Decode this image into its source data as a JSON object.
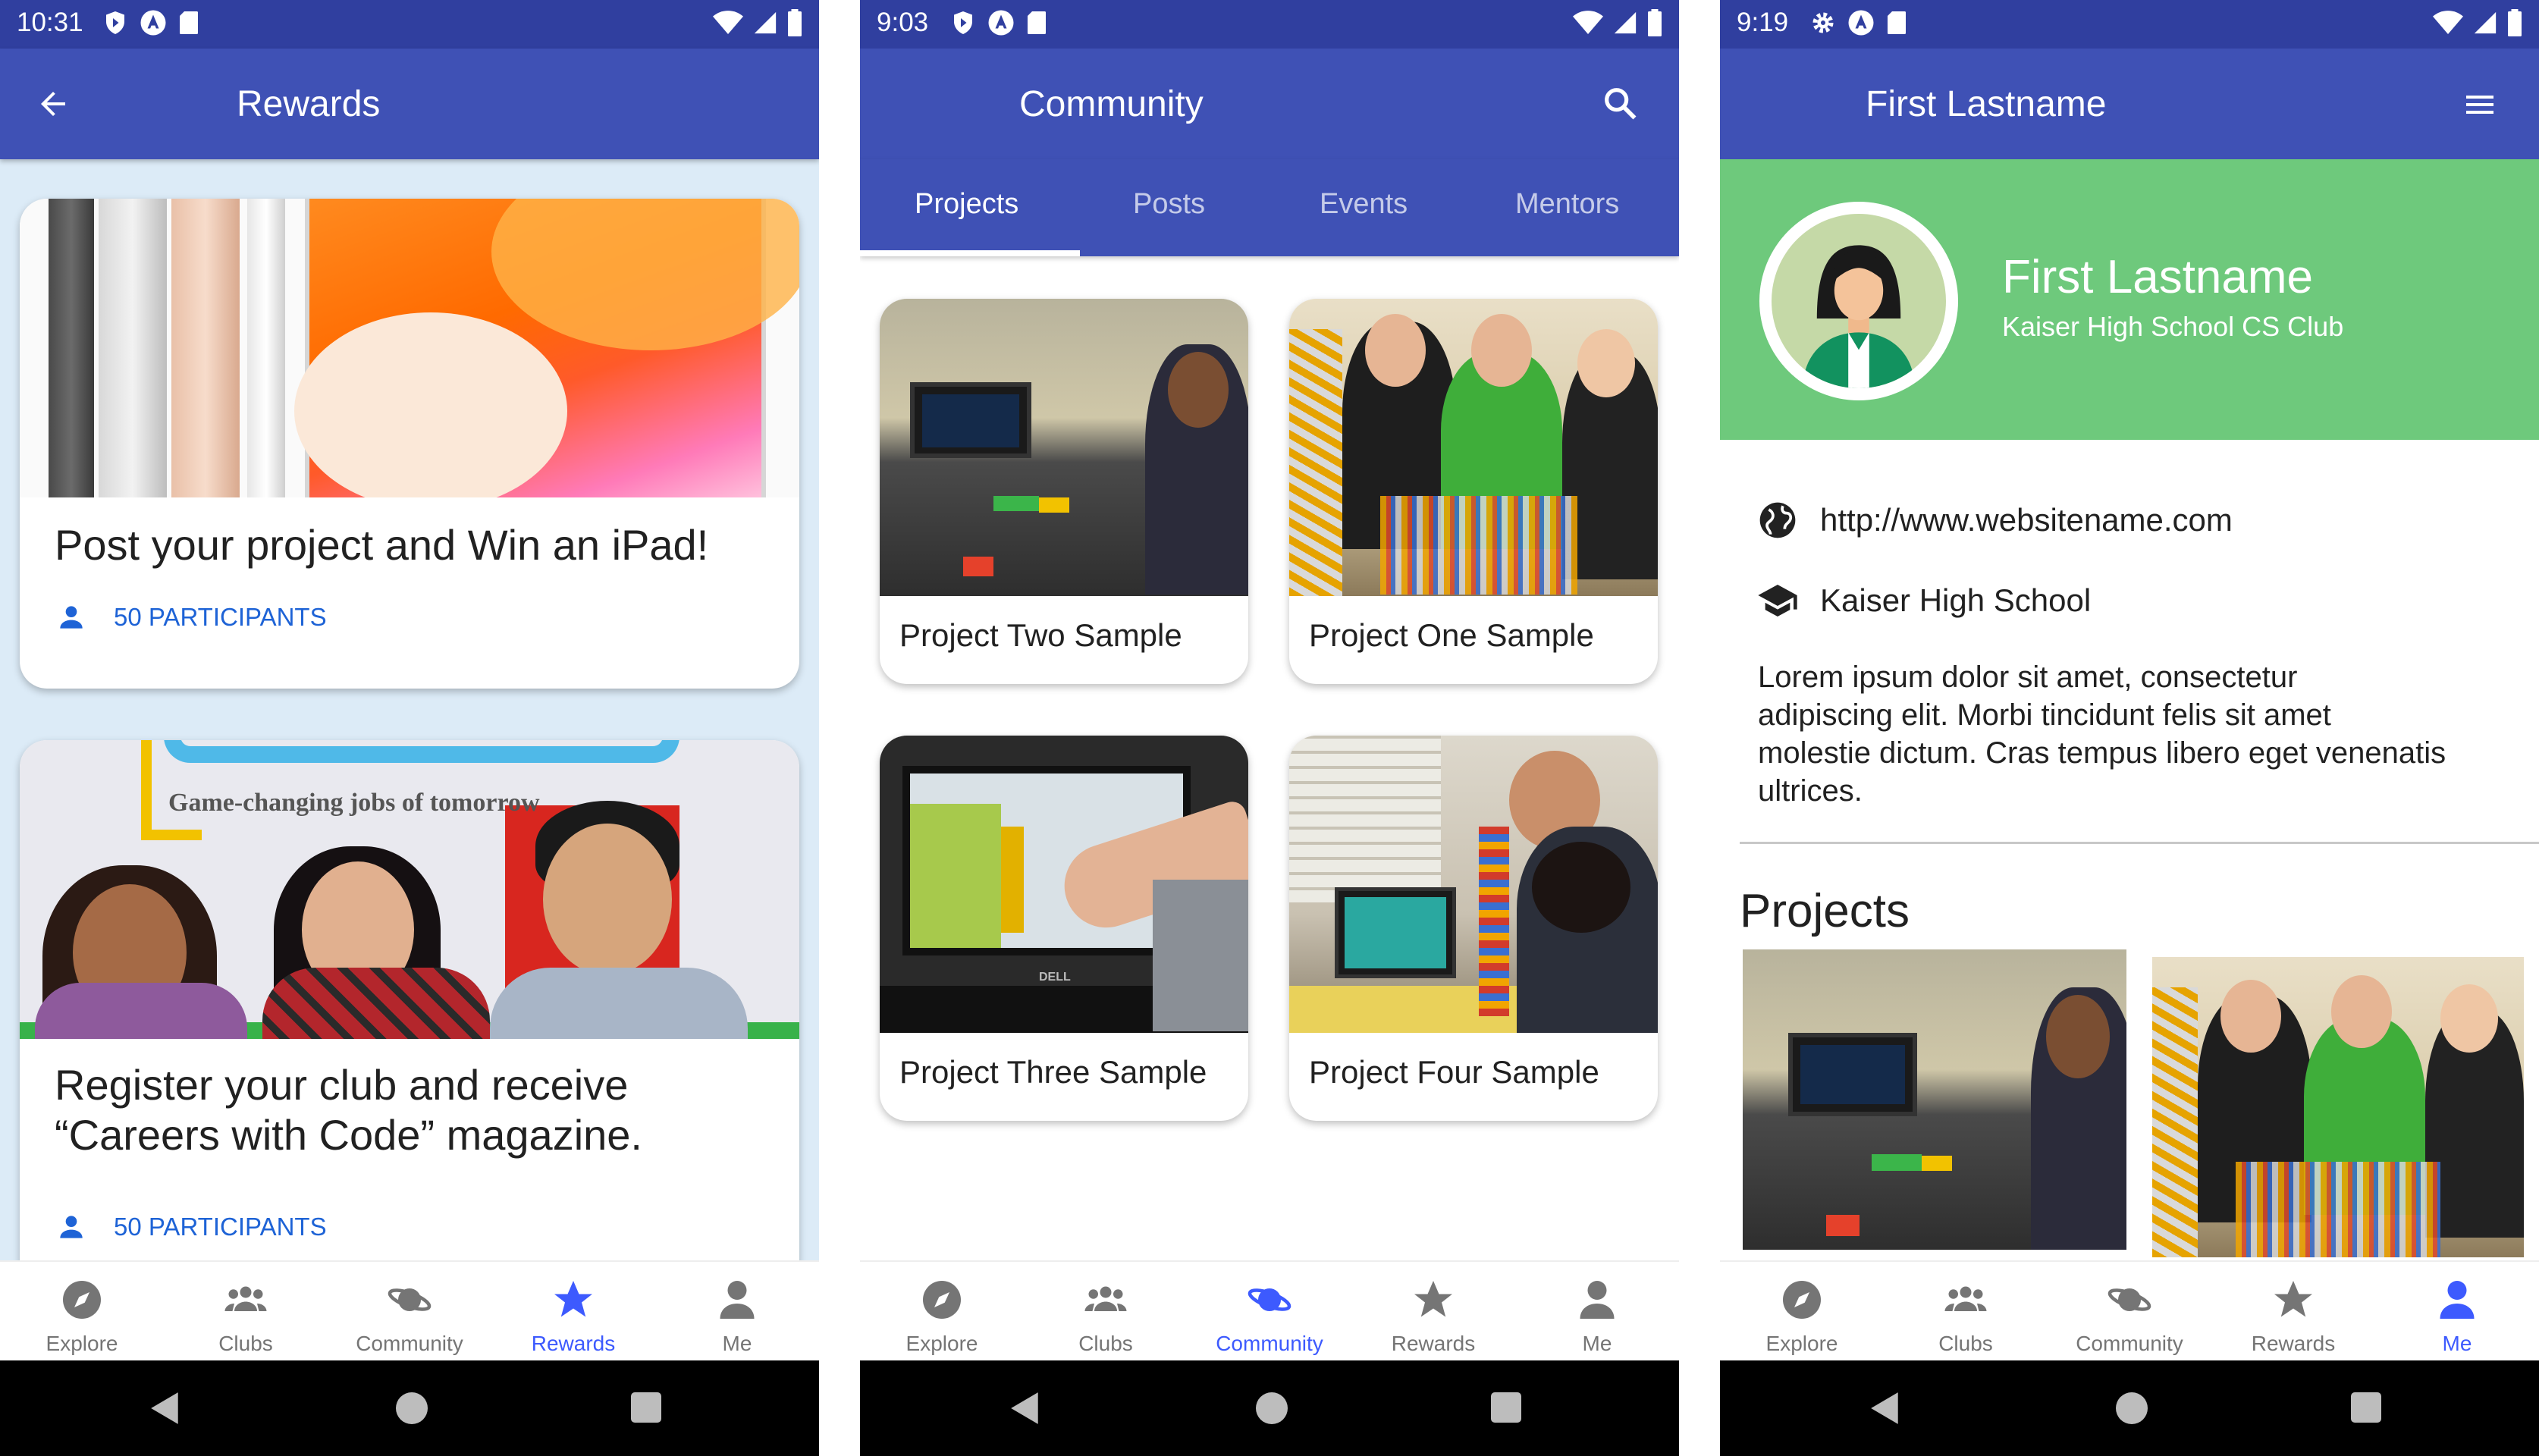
{
  "screens": [
    {
      "status_time": "10:31",
      "title": "Rewards",
      "rewards": [
        {
          "title_line1": "Post your project and Win an iPad!",
          "title_line2": "",
          "participants": "50 PARTICIPANTS"
        },
        {
          "title_line1": "Register your club and receive",
          "title_line2": "“Careers with Code” magazine.",
          "participants": "50 PARTICIPANTS"
        }
      ],
      "banner_text": "Game-changing jobs of tomorrow"
    },
    {
      "status_time": "9:03",
      "title": "Community",
      "tabs": [
        "Projects",
        "Posts",
        "Events",
        "Mentors"
      ],
      "projects": [
        "Project Two Sample",
        "Project One Sample",
        "Project Three Sample",
        "Project Four Sample"
      ]
    },
    {
      "status_time": "9:19",
      "title": "First Lastname",
      "profile": {
        "name": "First Lastname",
        "club": "Kaiser High School CS Club",
        "website": "http://www.websitename.com",
        "school": "Kaiser High School",
        "bio_lines": [
          "Lorem ipsum dolor sit amet, consectetur",
          "adipiscing elit. Morbi tincidunt felis sit amet",
          "molestie dictum. Cras tempus libero eget venenatis",
          "ultrices."
        ],
        "projects_heading": "Projects"
      }
    }
  ],
  "bottom_nav": [
    "Explore",
    "Clubs",
    "Community",
    "Rewards",
    "Me"
  ],
  "active_nav": [
    "Rewards",
    "Community",
    "Me"
  ],
  "icons": [
    "shield-play-icon",
    "android-icon",
    "sd-card-icon",
    "wifi-icon",
    "signal-icon",
    "battery-icon",
    "back-arrow-icon",
    "search-icon",
    "menu-icon",
    "person-icon",
    "globe-icon",
    "school-icon",
    "compass-icon",
    "group-icon",
    "planet-icon",
    "star-icon"
  ],
  "colors": {
    "status_bar": "#303f9f",
    "app_bar": "#3f51b5",
    "accent": "#3d5afe",
    "link_blue": "#1e63d6",
    "profile_banner": "#6ec97c",
    "rewards_bg": "#dcebf7"
  }
}
